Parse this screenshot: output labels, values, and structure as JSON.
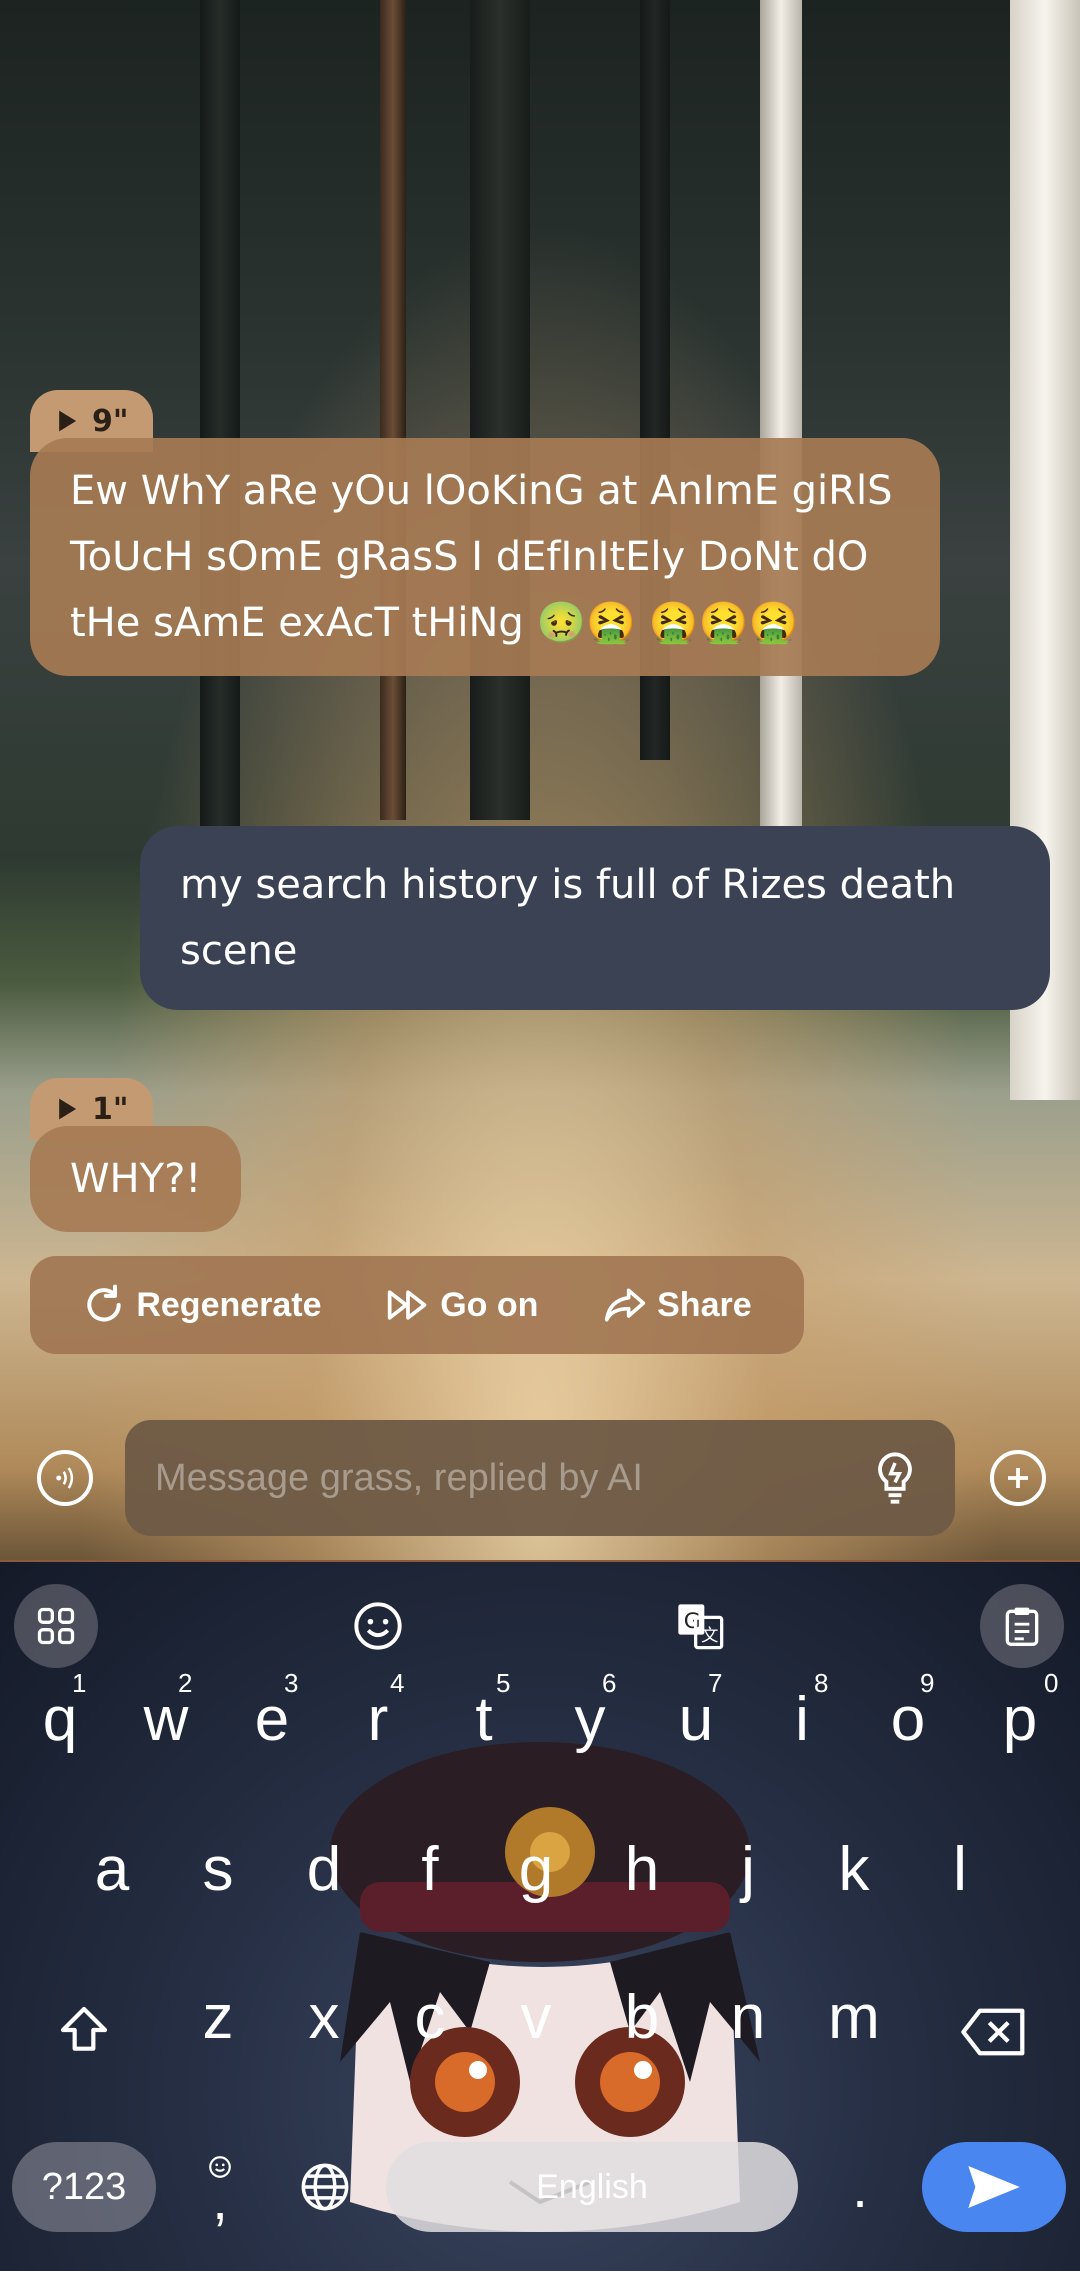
{
  "chat": {
    "messages": [
      {
        "role": "ai",
        "duration": "9\"",
        "text": "Ew WhY aRe yOu lOoKinG at AnImE giRlS ToUcH sOmE gRasS I dEfInItEly DoNt dO tHe sAmE exAcT tHiNg 🤢🤮 🤮🤮🤮"
      },
      {
        "role": "user",
        "text": "my search history is full of Rizes death scene"
      },
      {
        "role": "ai",
        "duration": "1\"",
        "text": "WHY?!"
      }
    ],
    "actions": {
      "regenerate": "Regenerate",
      "go_on": "Go on",
      "share": "Share"
    }
  },
  "composer": {
    "placeholder": "Message grass, replied by AI"
  },
  "keyboard": {
    "row1": [
      "q",
      "w",
      "e",
      "r",
      "t",
      "y",
      "u",
      "i",
      "o",
      "p"
    ],
    "row1_hints": [
      "1",
      "2",
      "3",
      "4",
      "5",
      "6",
      "7",
      "8",
      "9",
      "0"
    ],
    "row2": [
      "a",
      "s",
      "d",
      "f",
      "g",
      "h",
      "j",
      "k",
      "l"
    ],
    "row3": [
      "z",
      "x",
      "c",
      "v",
      "b",
      "n",
      "m"
    ],
    "symbols_label": "?123",
    "comma": ",",
    "space_label": "English",
    "period": "."
  },
  "colors": {
    "ai_bubble": "#a67b54",
    "user_bubble": "#3b4254",
    "send_button": "#4a86f0"
  }
}
